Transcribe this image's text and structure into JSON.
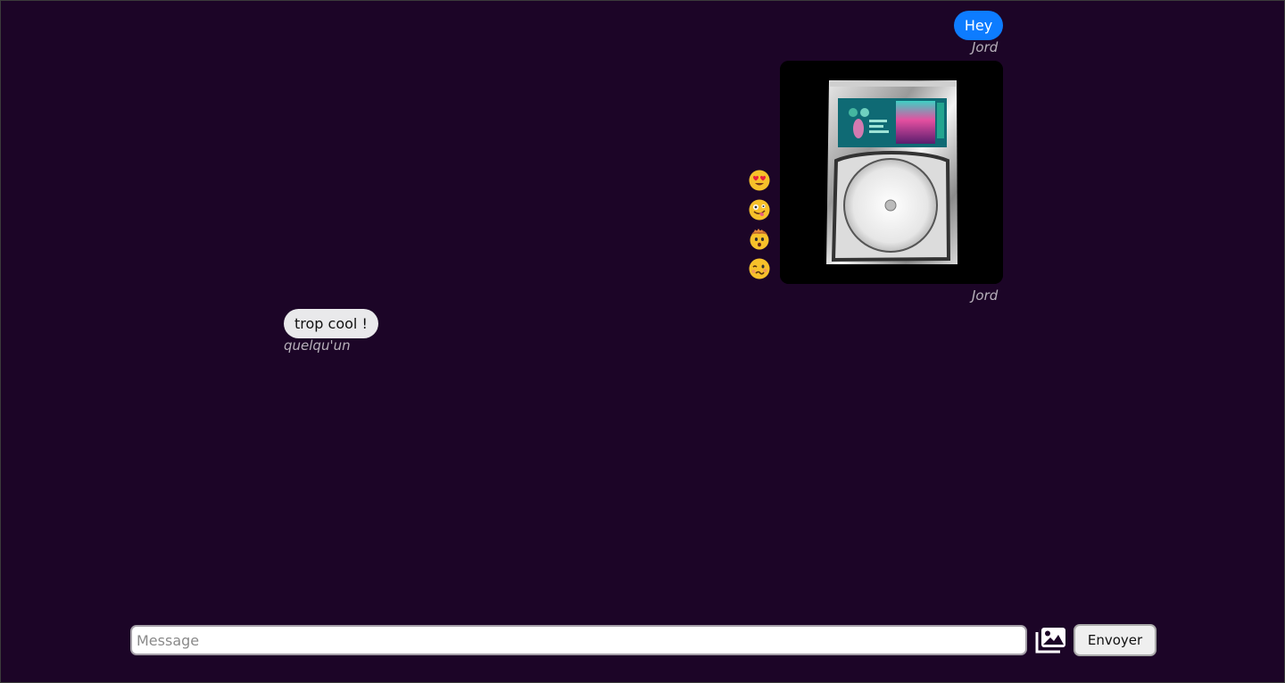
{
  "messages": [
    {
      "text": "Hey",
      "author": "Jord",
      "color": "#0d7cff"
    },
    {
      "type": "image",
      "author": "Jord"
    },
    {
      "text": "trop cool !",
      "author": "quelqu'un",
      "color": "#e9e9eb"
    }
  ],
  "reactions": [
    {
      "icon": "heart-eyes-emoji-icon"
    },
    {
      "icon": "zany-face-emoji-icon"
    },
    {
      "icon": "exploding-head-emoji-icon"
    },
    {
      "icon": "woozy-face-emoji-icon"
    }
  ],
  "composer": {
    "placeholder": "Message",
    "value": "",
    "image_button_icon": "images-icon",
    "send_label": "Envoyer"
  },
  "colors": {
    "background": "#1c0527",
    "own_bubble": "#0d7cff",
    "other_bubble": "#e9e9eb"
  }
}
